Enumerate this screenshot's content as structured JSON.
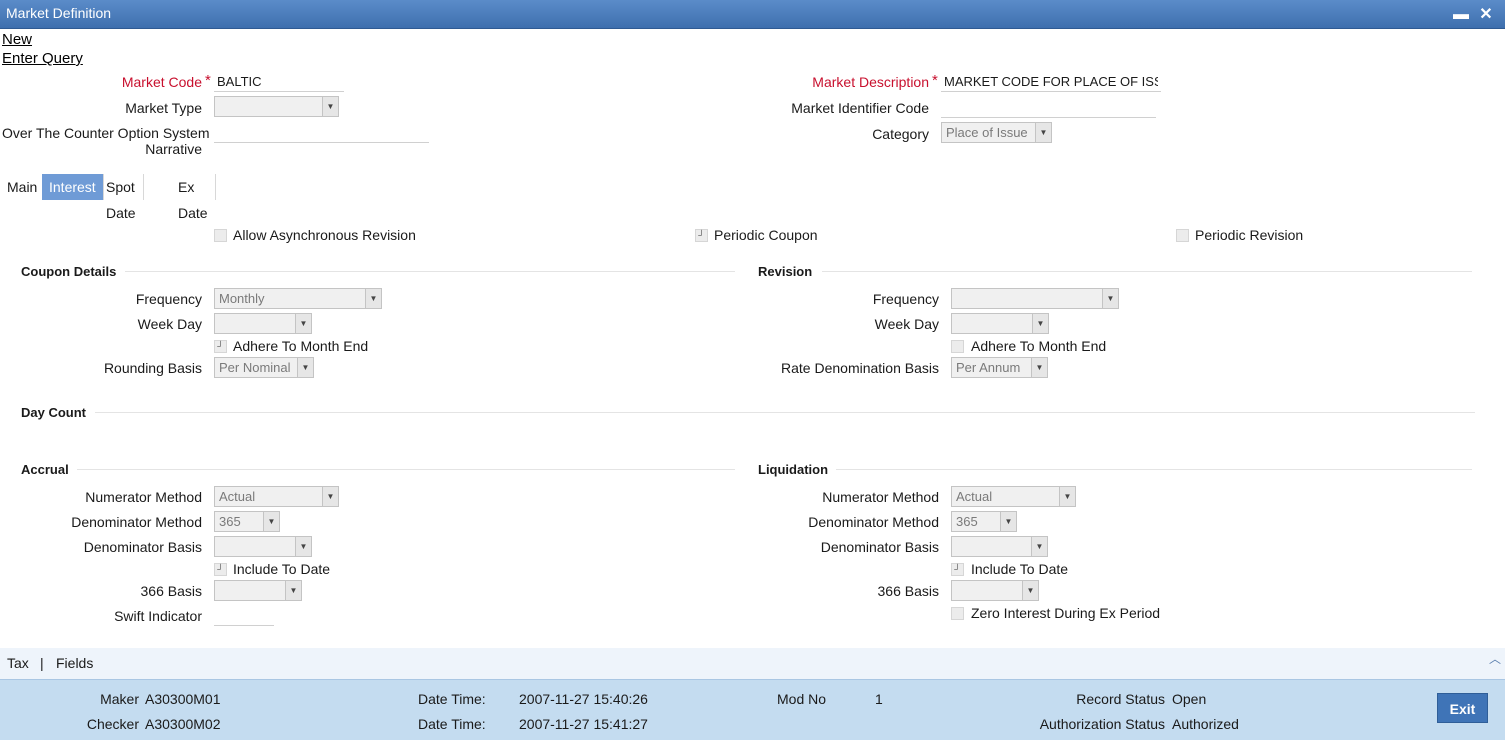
{
  "window": {
    "title": "Market Definition",
    "minimize_glyph": "▬",
    "close_glyph": "✕"
  },
  "menu": {
    "new": "New",
    "enter_query": "Enter Query"
  },
  "header": {
    "market_code_label": "Market Code",
    "market_code_value": "BALTIC",
    "market_type_label": "Market Type",
    "market_type_value": "",
    "otc_label_line1": "Over The Counter Option System",
    "otc_label_line2": "Narrative",
    "otc_value": "",
    "market_description_label": "Market Description",
    "market_description_value": "MARKET CODE FOR PLACE OF ISS",
    "mic_label": "Market Identifier Code",
    "mic_value": "",
    "category_label": "Category",
    "category_value": "Place of Issue",
    "required_mark": "*"
  },
  "tabs": [
    {
      "label": "Main",
      "active": false
    },
    {
      "label": "Interest",
      "active": true
    },
    {
      "label": "Spot Date",
      "active": false
    },
    {
      "label": "Ex Date",
      "active": false
    }
  ],
  "options": {
    "allow_async_revision": "Allow Asynchronous Revision",
    "periodic_coupon": "Periodic Coupon",
    "periodic_revision": "Periodic Revision"
  },
  "coupon": {
    "title": "Coupon Details",
    "frequency_label": "Frequency",
    "frequency_value": "Monthly",
    "week_day_label": "Week Day",
    "week_day_value": "",
    "adhere_label": "Adhere To Month End",
    "rounding_basis_label": "Rounding Basis",
    "rounding_basis_value": "Per Nominal"
  },
  "revision": {
    "title": "Revision",
    "frequency_label": "Frequency",
    "frequency_value": "",
    "week_day_label": "Week Day",
    "week_day_value": "",
    "adhere_label": "Adhere To Month End",
    "rate_denom_label": "Rate Denomination Basis",
    "rate_denom_value": "Per Annum"
  },
  "day_count": {
    "title": "Day Count"
  },
  "accrual": {
    "title": "Accrual",
    "numerator_label": "Numerator Method",
    "numerator_value": "Actual",
    "denominator_method_label": "Denominator Method",
    "denominator_method_value": "365",
    "denominator_basis_label": "Denominator Basis",
    "denominator_basis_value": "",
    "include_to_date_label": "Include To Date",
    "basis366_label": "366 Basis",
    "basis366_value": "",
    "swift_label": "Swift Indicator",
    "swift_value": ""
  },
  "liquidation": {
    "title": "Liquidation",
    "numerator_label": "Numerator Method",
    "numerator_value": "Actual",
    "denominator_method_label": "Denominator Method",
    "denominator_method_value": "365",
    "denominator_basis_label": "Denominator Basis",
    "denominator_basis_value": "",
    "include_to_date_label": "Include To Date",
    "basis366_label": "366 Basis",
    "basis366_value": "",
    "zero_interest_label": "Zero Interest During Ex Period"
  },
  "footer_links": {
    "tax": "Tax",
    "separator": "|",
    "fields": "Fields",
    "scroll_glyph": "︿"
  },
  "status": {
    "maker_label": "Maker",
    "maker_value": "A30300M01",
    "checker_label": "Checker",
    "checker_value": "A30300M02",
    "date_time_label": "Date Time:",
    "maker_date_time": "2007-11-27 15:40:26",
    "checker_date_time": "2007-11-27 15:41:27",
    "mod_no_label": "Mod No",
    "mod_no_value": "1",
    "record_status_label": "Record Status",
    "record_status_value": "Open",
    "auth_status_label": "Authorization Status",
    "auth_status_value": "Authorized",
    "exit_label": "Exit"
  },
  "glyphs": {
    "dropdown": "▼",
    "checkbox_mark": "┘"
  }
}
